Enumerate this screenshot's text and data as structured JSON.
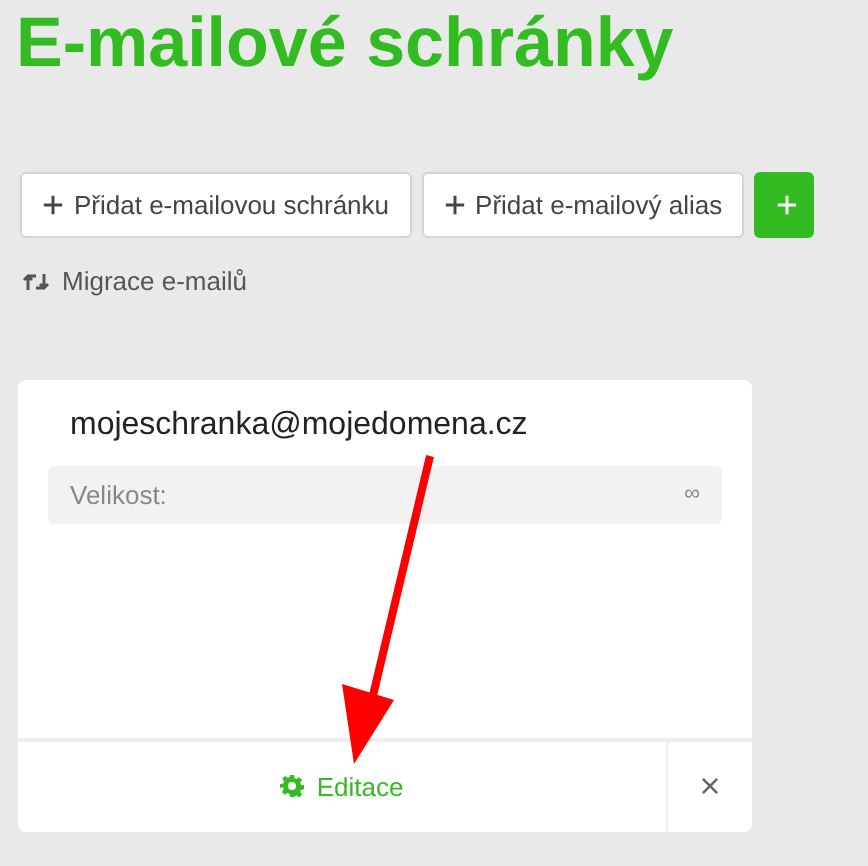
{
  "title": "E-mailové schránky",
  "actions": [
    {
      "kind": "outline",
      "label": "Přidat e-mailovou schránku"
    },
    {
      "kind": "outline",
      "label": "Přidat e-mailový alias"
    },
    {
      "kind": "primary"
    }
  ],
  "migration_link": "Migrace e-mailů",
  "mailbox": {
    "address": "mojeschranka@mojedomena.cz",
    "size_label": "Velikost:",
    "size_value": "∞",
    "edit_label": "Editace",
    "delete_label": "×"
  }
}
